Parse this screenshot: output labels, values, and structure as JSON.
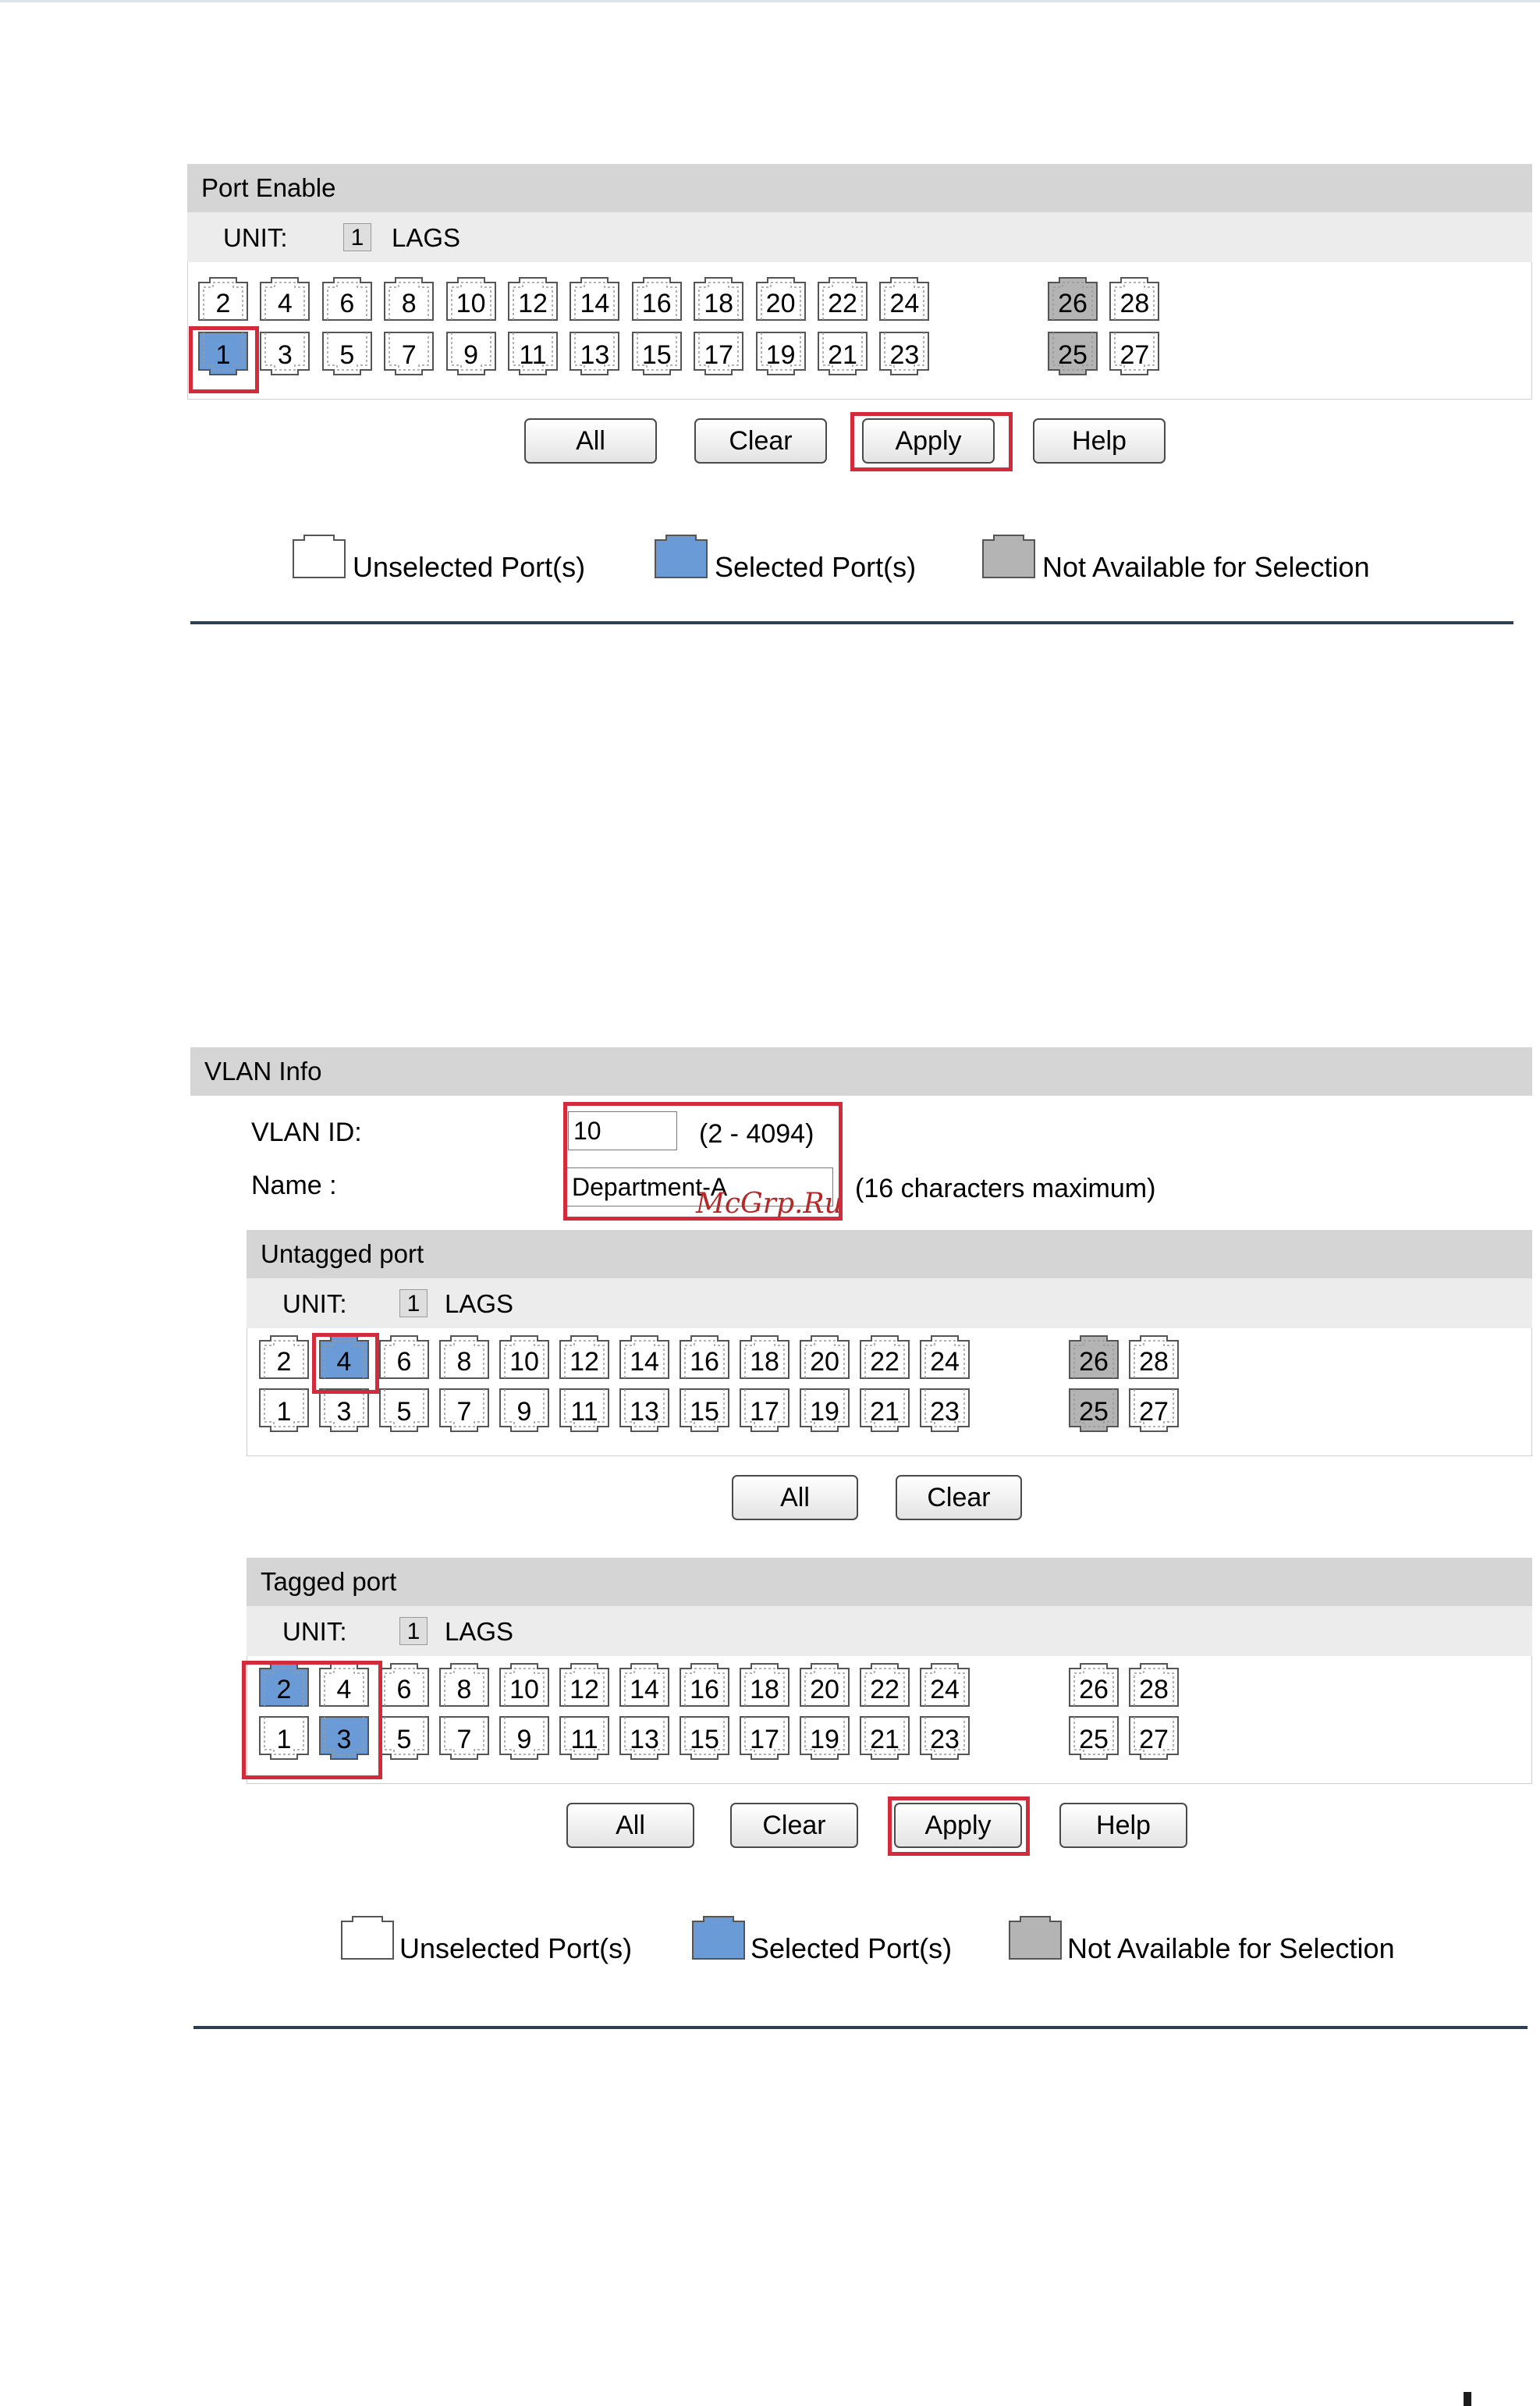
{
  "port_enable": {
    "header": "Port Enable",
    "unit_label": "UNIT:",
    "unit_value": "1",
    "lags_label": "LAGS",
    "buttons": {
      "all": "All",
      "clear": "Clear",
      "apply": "Apply",
      "help": "Help"
    }
  },
  "vlan_info": {
    "header": "VLAN Info",
    "vlan_id_label": "VLAN ID:",
    "vlan_id_value": "10",
    "vlan_id_range": "(2 - 4094)",
    "name_label": "Name :",
    "name_value": "Department-A",
    "name_hint": "(16 characters maximum)",
    "untagged": {
      "header": "Untagged port",
      "unit_label": "UNIT:",
      "unit_value": "1",
      "lags_label": "LAGS",
      "buttons": {
        "all": "All",
        "clear": "Clear"
      }
    },
    "tagged": {
      "header": "Tagged port",
      "unit_label": "UNIT:",
      "unit_value": "1",
      "lags_label": "LAGS",
      "buttons": {
        "all": "All",
        "clear": "Clear",
        "apply": "Apply",
        "help": "Help"
      }
    }
  },
  "legend": {
    "unselected": "Unselected Port(s)",
    "selected": "Selected Port(s)",
    "not_available": "Not Available for Selection"
  },
  "ports": {
    "top_row": [
      "2",
      "4",
      "6",
      "8",
      "10",
      "12",
      "14",
      "16",
      "18",
      "20",
      "22",
      "24"
    ],
    "bottom_row": [
      "1",
      "3",
      "5",
      "7",
      "9",
      "11",
      "13",
      "15",
      "17",
      "19",
      "21",
      "23"
    ],
    "extra_top": [
      "26",
      "28"
    ],
    "extra_bottom": [
      "25",
      "27"
    ],
    "port_enable_selected": [
      "1"
    ],
    "port_enable_unavailable": [
      "25",
      "26"
    ],
    "untagged_selected": [
      "4"
    ],
    "untagged_unavailable": [
      "25",
      "26"
    ],
    "tagged_selected": [
      "2",
      "3"
    ],
    "tagged_unavailable": []
  },
  "watermark": "McGrp.Ru",
  "colors": {
    "header_bg": "#d5d5d5",
    "unit_bg": "#ececec",
    "selected_port": "#6b9bd6",
    "unavailable_port": "#b4b4b4",
    "highlight_red": "#d42b3c",
    "rule": "#2d3e50"
  }
}
